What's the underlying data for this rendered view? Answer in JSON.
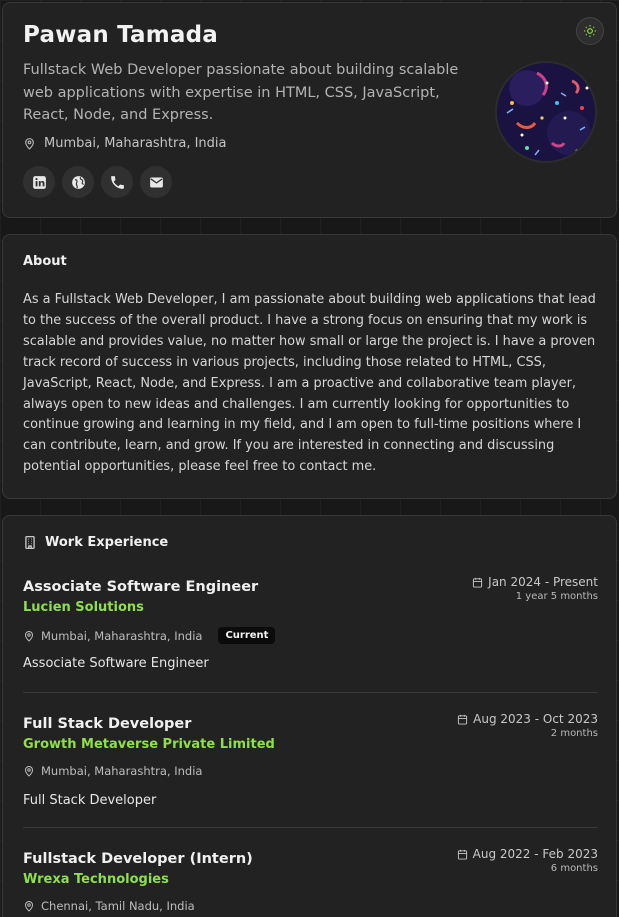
{
  "profile": {
    "name": "Pawan Tamada",
    "tagline": "Fullstack Web Developer passionate about building scalable web applications with expertise in HTML, CSS, JavaScript, React, Node, and Express.",
    "location": "Mumbai, Maharashtra, India",
    "socials": [
      {
        "icon": "linkedin-icon"
      },
      {
        "icon": "globe-icon"
      },
      {
        "icon": "phone-icon"
      },
      {
        "icon": "mail-icon"
      }
    ],
    "theme_toggle_icon": "sun-icon"
  },
  "about": {
    "title": "About",
    "text": "As a Fullstack Web Developer, I am passionate about building web applications that lead to the success of the overall product. I have a strong focus on ensuring that my work is scalable and provides value, no matter how small or large the project is. I have a proven track record of success in various projects, including those related to HTML, CSS, JavaScript, React, Node, and Express. I am a proactive and collaborative team player, always open to new ideas and challenges. I am currently looking for opportunities to continue growing and learning in my field, and I am open to full-time positions where I can contribute, learn, and grow. If you are interested in connecting and discussing potential opportunities, please feel free to contact me."
  },
  "work": {
    "title": "Work Experience",
    "jobs": [
      {
        "title": "Associate Software Engineer",
        "company": "Lucien Solutions",
        "location": "Mumbai, Maharashtra, India",
        "badge": "Current",
        "description": "Associate Software Engineer",
        "dates": "Jan 2024 - Present",
        "duration": "1 year 5 months"
      },
      {
        "title": "Full Stack Developer",
        "company": "Growth Metaverse Private Limited",
        "location": "Mumbai, Maharashtra, India",
        "description": "Full Stack Developer",
        "dates": "Aug 2023 - Oct 2023",
        "duration": "2 months"
      },
      {
        "title": "Fullstack Developer (Intern)",
        "company": "Wrexa Technologies",
        "location": "Chennai, Tamil Nadu, India",
        "dates": "Aug 2022 - Feb 2023",
        "duration": "6 months"
      }
    ]
  },
  "colors": {
    "accent": "#8ee04a",
    "card": "#222223",
    "background": "#181818"
  }
}
